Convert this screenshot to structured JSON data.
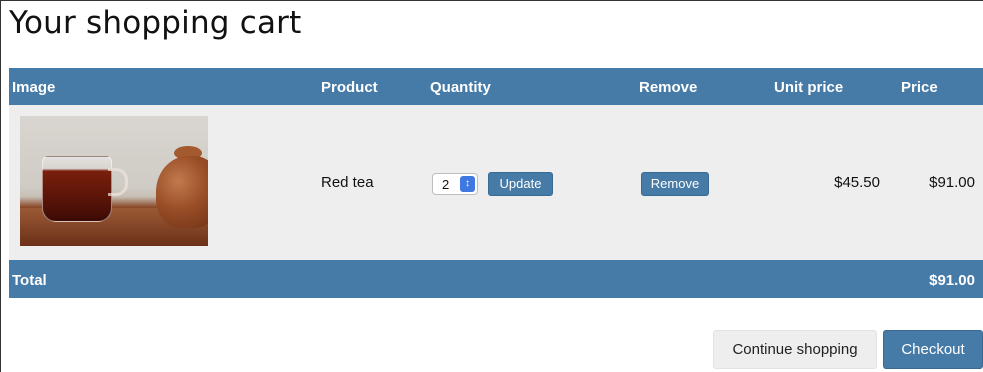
{
  "page": {
    "title": "Your shopping cart"
  },
  "table": {
    "headers": {
      "image": "Image",
      "product": "Product",
      "quantity": "Quantity",
      "remove": "Remove",
      "unit_price": "Unit price",
      "price": "Price"
    },
    "rows": [
      {
        "image_icon": "red-tea-product-photo",
        "product": "Red tea",
        "quantity": "2",
        "update_label": "Update",
        "remove_label": "Remove",
        "unit_price": "$45.50",
        "price": "$91.00"
      }
    ],
    "total": {
      "label": "Total",
      "value": "$91.00"
    }
  },
  "actions": {
    "continue_label": "Continue shopping",
    "checkout_label": "Checkout"
  },
  "colors": {
    "accent": "#467aa7",
    "row_background": "#eeeeee",
    "secondary_button": "#eeeeee",
    "stepper": "#3f78e0"
  }
}
